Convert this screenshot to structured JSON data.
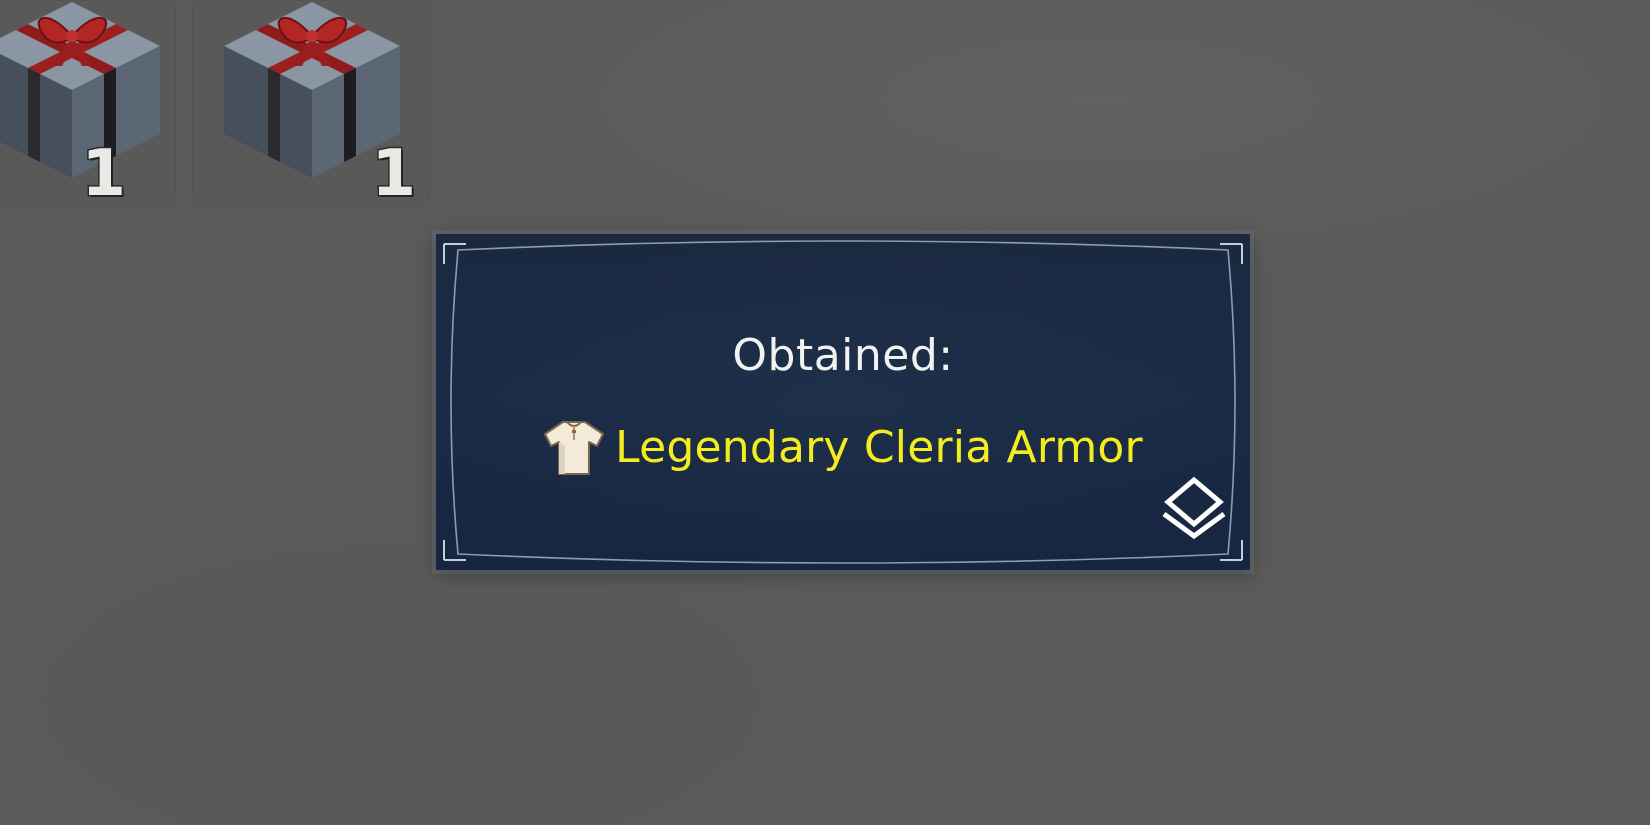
{
  "inventory": {
    "slots": [
      {
        "icon": "gift-box-icon",
        "count": "1"
      },
      {
        "icon": "gift-box-icon",
        "count": "1"
      }
    ]
  },
  "dialog": {
    "title": "Obtained:",
    "item": {
      "icon": "shirt-armor-icon",
      "name": "Legendary Cleria Armor",
      "name_color": "#f3ec1e"
    },
    "confirm_icon": "double-chevron-icon"
  },
  "colors": {
    "background": "#5a5a58",
    "dialog_bg": "#1b2b45",
    "item_highlight": "#f3ec1e",
    "text": "#f2f2f0"
  }
}
